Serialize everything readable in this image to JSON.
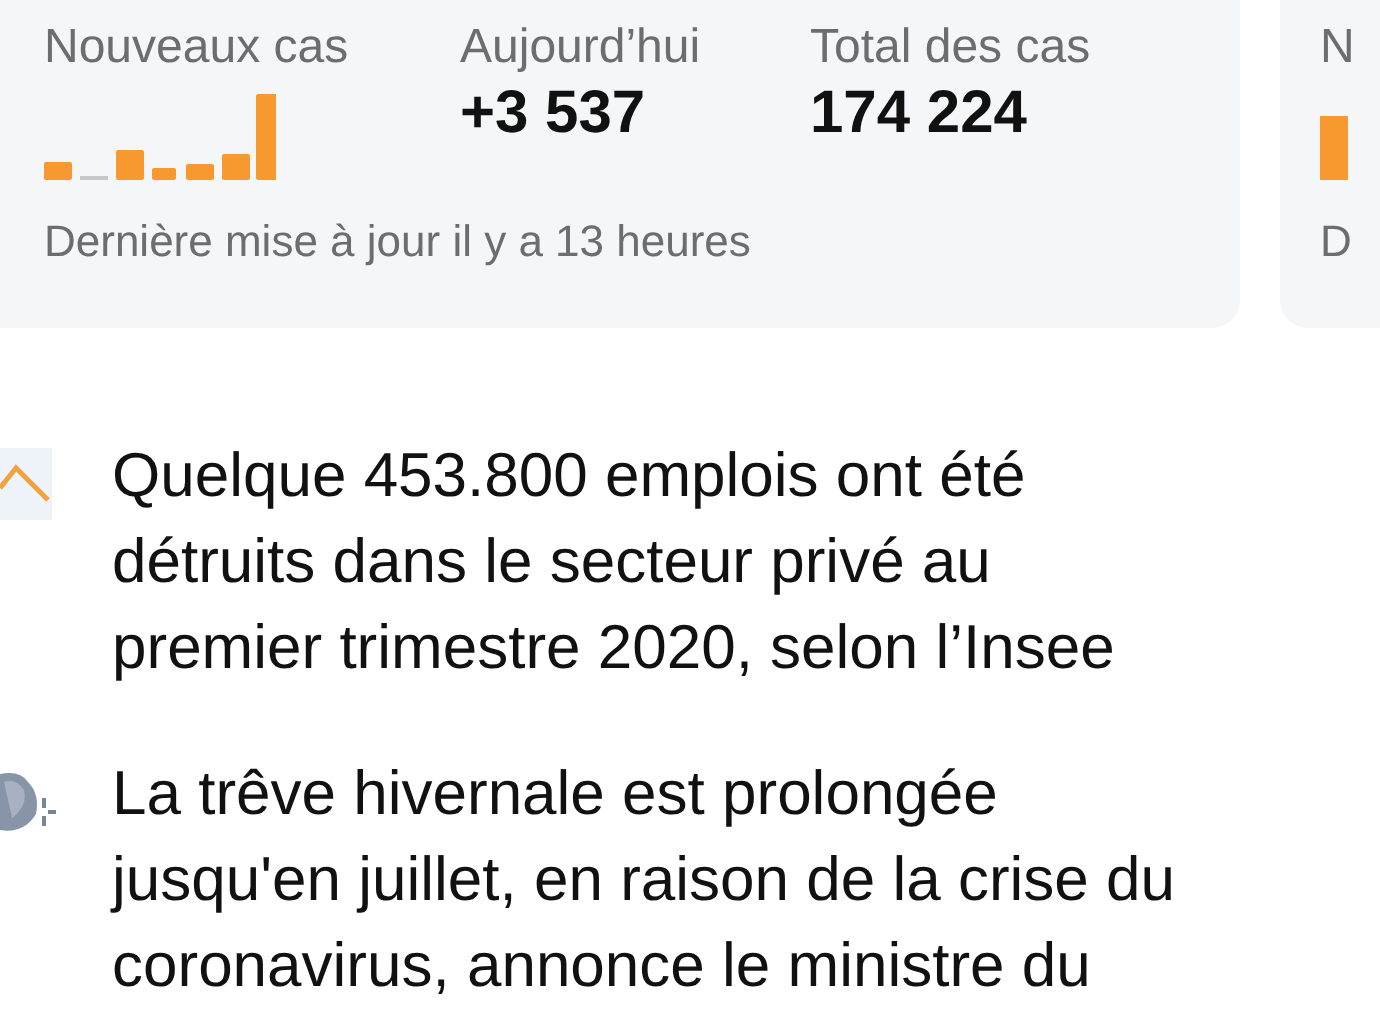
{
  "cards": [
    {
      "title": "Nouveaux cas",
      "stats": [
        {
          "label": "Aujourd’hui",
          "value": "+3 537"
        },
        {
          "label": "Total des cas",
          "value": "174 224"
        }
      ],
      "footer": "Dernière mise à jour il y a 13 heures"
    },
    {
      "title": "N",
      "footer": "D"
    }
  ],
  "news": [
    {
      "kind": "chart",
      "text": "Quelque 453.800 emplois ont été\ndétruits dans le secteur privé au\npremier trimestre 2020, selon l’Insee"
    },
    {
      "kind": "picture",
      "text": "La trêve hivernale est prolongée\njusqu'en juillet, en raison de la crise du\ncoronavirus, annonce le ministre du"
    }
  ]
}
